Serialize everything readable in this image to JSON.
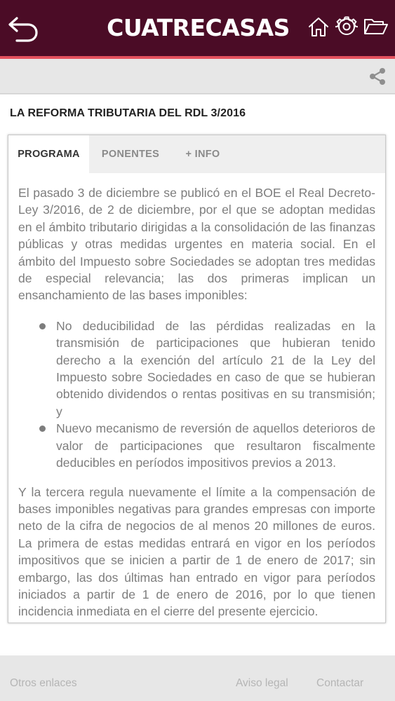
{
  "colors": {
    "header_bg": "#4b0c26",
    "accent": "#e3525e",
    "text_gray": "#7d7d7d"
  },
  "header": {
    "brand": "CUATRECASAS",
    "icons": [
      "back-arrow-icon",
      "home-icon",
      "gear-icon",
      "folder-icon"
    ]
  },
  "toolbar": {
    "icons": [
      "share-icon"
    ]
  },
  "page": {
    "title": "LA REFORMA TRIBUTARIA DEL RDL 3/2016"
  },
  "tabs": [
    {
      "label": "PROGRAMA",
      "active": true
    },
    {
      "label": "PONENTES",
      "active": false
    },
    {
      "label": "+ INFO",
      "active": false
    }
  ],
  "article": {
    "p1": "El pasado 3 de diciembre se publicó en el BOE el Real Decreto-Ley 3/2016, de 2 de diciembre, por el que se adoptan medidas en el ámbito tributario dirigidas a la consolidación de las finanzas públicas y otras medidas urgentes en materia social. En el ámbito del Impuesto sobre Sociedades se adoptan tres medidas de especial relevancia; las dos primeras implican un ensanchamiento de las bases imponibles:",
    "bullets": [
      "No deducibilidad de las pérdidas realizadas en la transmisión de participaciones que hubieran tenido derecho a la exención del artículo 21 de la Ley del Impuesto sobre Sociedades en caso de que se hubieran obtenido dividendos o rentas positivas en su transmisión; y",
      "Nuevo mecanismo de reversión de aquellos deterioros de valor de participaciones que resultaron fiscalmente deducibles en períodos impositivos previos a 2013."
    ],
    "p2": "Y la tercera regula nuevamente el límite a la compensación de bases imponibles negativas para grandes empresas con importe neto de la cifra de negocios de al menos 20 millones de euros. La primera de estas medidas entrará en vigor en los períodos impositivos que se inicien a partir de 1 de enero de 2017; sin embargo, las dos últimas han entrado en vigor para períodos iniciados a partir de 1 de enero de 2016, por lo que tienen incidencia inmediata en el cierre del presente ejercicio."
  },
  "footer": {
    "other_links": "Otros enlaces",
    "legal": "Aviso legal",
    "contact": "Contactar"
  }
}
